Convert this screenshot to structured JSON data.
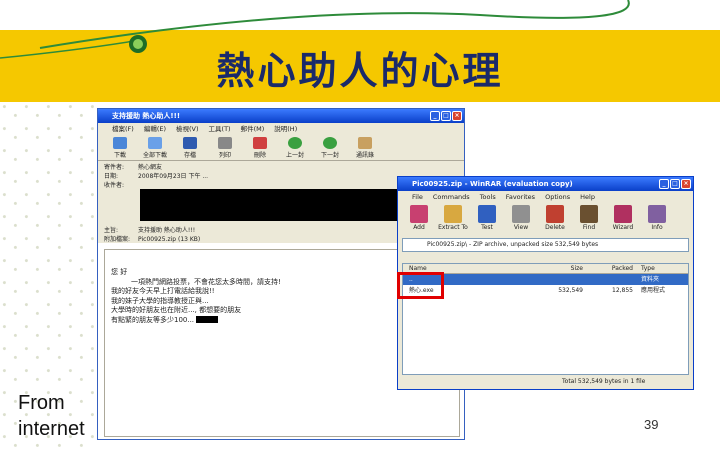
{
  "slide": {
    "title": "熱心助人的心理",
    "source_note": "From internet",
    "page_number": "39",
    "colors": {
      "title_band": "#f5c800",
      "title_text": "#1a2a6a",
      "highlight_box": "#e00000"
    }
  },
  "email_window": {
    "title": "支持援助 熱心助人!!!",
    "menu": [
      "檔案(F)",
      "編輯(E)",
      "檢視(V)",
      "工具(T)",
      "郵件(M)",
      "說明(H)"
    ],
    "toolbar": [
      {
        "label": "下載",
        "icon": "download-icon"
      },
      {
        "label": "全部下載",
        "icon": "download-all-icon"
      },
      {
        "label": "存檔",
        "icon": "save-icon"
      },
      {
        "label": "列印",
        "icon": "print-icon"
      },
      {
        "label": "刪除",
        "icon": "delete-icon"
      },
      {
        "label": "上一封",
        "icon": "up-arrow-icon"
      },
      {
        "label": "下一封",
        "icon": "down-arrow-icon"
      },
      {
        "label": "通訊錄",
        "icon": "address-book-icon"
      }
    ],
    "header": {
      "from_label": "寄件者:",
      "from_value": "熱心網友",
      "date_label": "日期:",
      "date_value": "2008年09月23日 下午 ...",
      "to_label": "收件者:",
      "subject_label": "主旨:",
      "subject_value": "支持援助 熱心助人!!!",
      "attachment_label": "附加檔案:",
      "attachment_value": "Pic00925.zip (13 KB)"
    },
    "body_lines": [
      "您 好",
      "         一項熱門網路投票，不會花您太多時間，請支持!",
      "我的好友今天早上打電話給我說!!",
      "我的妹子大學的指導教授正與...",
      "大學時的好朋友也在附近..., 都想要的朋友",
      "有點緊的朋友等多少100..."
    ]
  },
  "rar_window": {
    "title": "Pic00925.zip - WinRAR (evaluation copy)",
    "menu": [
      "File",
      "Commands",
      "Tools",
      "Favorites",
      "Options",
      "Help"
    ],
    "tools": [
      "Add",
      "Extract To",
      "Test",
      "View",
      "Delete",
      "Find",
      "Wizard",
      "Info"
    ],
    "path": "Pic00925.zip\\ - ZIP archive, unpacked size 532,549 bytes",
    "columns": [
      "Name",
      "Size",
      "Packed",
      "Type"
    ],
    "rows": [
      {
        "name": "..",
        "size": "",
        "packed": "",
        "type": "資料夾"
      },
      {
        "name": "熱心.exe",
        "size": "532,549",
        "packed": "12,855",
        "type": "應用程式"
      }
    ],
    "status": "Total 532,549 bytes in 1 file"
  }
}
